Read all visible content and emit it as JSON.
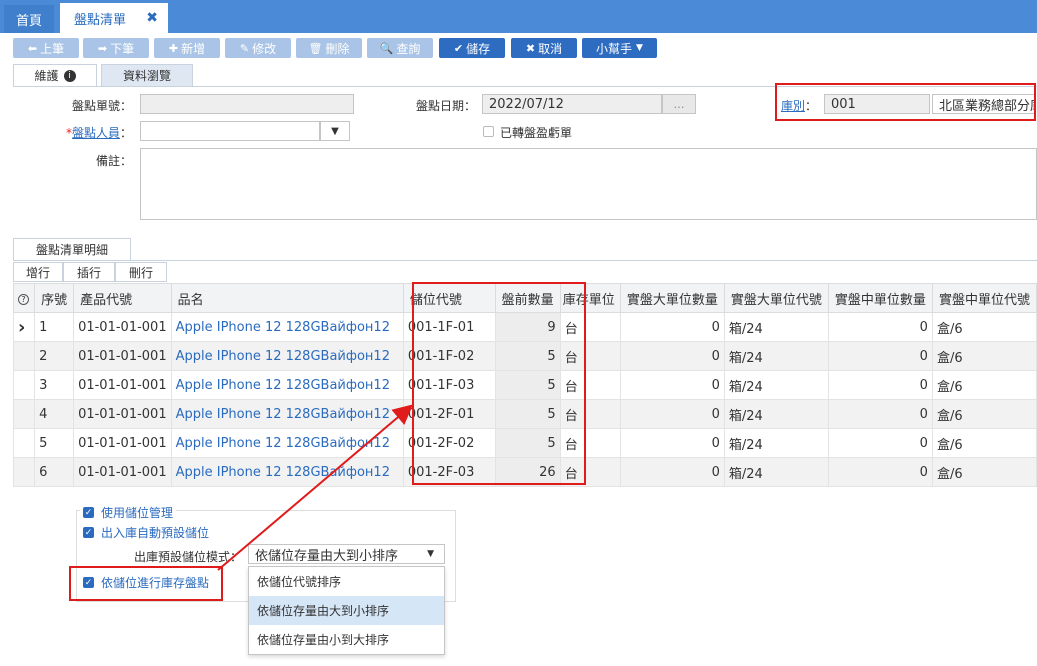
{
  "tabs": {
    "home": "首頁",
    "active": "盤點清單"
  },
  "toolbar": {
    "prev": "上筆",
    "next": "下筆",
    "add": "新增",
    "edit": "修改",
    "delete": "刪除",
    "query": "查詢",
    "save": "儲存",
    "cancel": "取消",
    "helper": "小幫手"
  },
  "form_tabs": {
    "maintain": "維護",
    "browse": "資料瀏覽"
  },
  "form": {
    "doc_no_label": "盤點單號：",
    "date_label": "盤點日期：",
    "date_value": "2022/07/12",
    "warehouse_label": "庫別",
    "warehouse_code": "001",
    "warehouse_name": "北區業務總部分庫",
    "staff_label": "盤點人員",
    "converted_label": "已轉盤盈虧單",
    "remark_label": "備註："
  },
  "detail": {
    "tab": "盤點清單明細",
    "row_btns": {
      "add": "增行",
      "insert": "插行",
      "delete": "刪行"
    },
    "columns": [
      "序號",
      "產品代號",
      "品名",
      "儲位代號",
      "盤前數量",
      "庫存單位",
      "實盤大單位數量",
      "實盤大單位代號",
      "實盤中單位數量",
      "實盤中單位代號"
    ],
    "rows": [
      {
        "seq": "1",
        "code": "01-01-01-001",
        "name": "Apple IPhone 12 128GВайфон12",
        "loc": "001-1F-01",
        "qty": "9",
        "unit": "台",
        "big_qty": "0",
        "big_code": "箱/24",
        "mid_qty": "0",
        "mid_code": "盒/6"
      },
      {
        "seq": "2",
        "code": "01-01-01-001",
        "name": "Apple IPhone 12 128GВайфон12",
        "loc": "001-1F-02",
        "qty": "5",
        "unit": "台",
        "big_qty": "0",
        "big_code": "箱/24",
        "mid_qty": "0",
        "mid_code": "盒/6"
      },
      {
        "seq": "3",
        "code": "01-01-01-001",
        "name": "Apple IPhone 12 128GВайфон12",
        "loc": "001-1F-03",
        "qty": "5",
        "unit": "台",
        "big_qty": "0",
        "big_code": "箱/24",
        "mid_qty": "0",
        "mid_code": "盒/6"
      },
      {
        "seq": "4",
        "code": "01-01-01-001",
        "name": "Apple IPhone 12 128GВайфон12",
        "loc": "001-2F-01",
        "qty": "5",
        "unit": "台",
        "big_qty": "0",
        "big_code": "箱/24",
        "mid_qty": "0",
        "mid_code": "盒/6"
      },
      {
        "seq": "5",
        "code": "01-01-01-001",
        "name": "Apple IPhone 12 128GВайфон12",
        "loc": "001-2F-02",
        "qty": "5",
        "unit": "台",
        "big_qty": "0",
        "big_code": "箱/24",
        "mid_qty": "0",
        "mid_code": "盒/6"
      },
      {
        "seq": "6",
        "code": "01-01-01-001",
        "name": "Apple IPhone 12 128GВайфон12",
        "loc": "001-2F-03",
        "qty": "26",
        "unit": "台",
        "big_qty": "0",
        "big_code": "箱/24",
        "mid_qty": "0",
        "mid_code": "盒/6"
      }
    ]
  },
  "settings": {
    "use_location": "使用儲位管理",
    "auto_default": "出入庫自動預設儲位",
    "mode_label": "出庫預設儲位模式：",
    "mode_value": "依儲位存量由大到小排序",
    "count_by_location": "依儲位進行庫存盤點",
    "options": [
      "依儲位代號排序",
      "依儲位存量由大到小排序",
      "依儲位存量由小到大排序"
    ]
  }
}
